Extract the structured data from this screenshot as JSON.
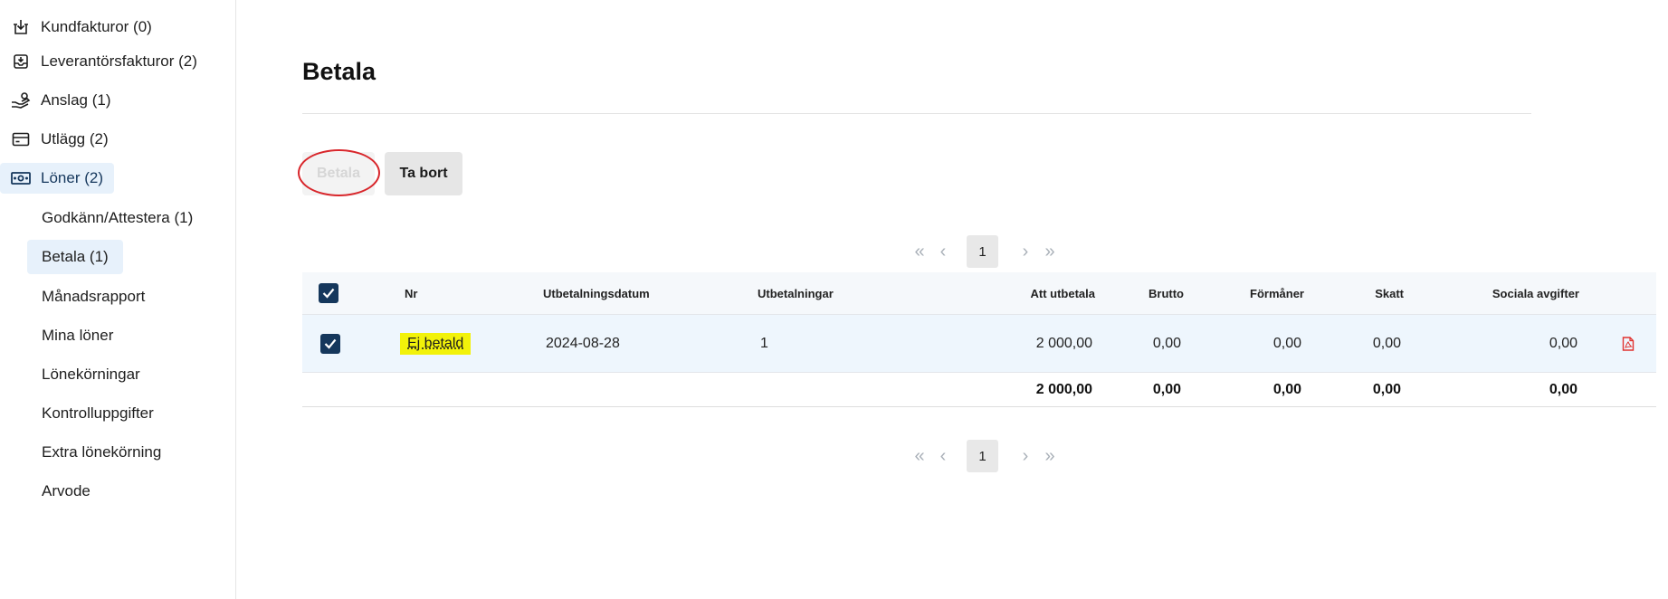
{
  "sidebar": {
    "items": [
      {
        "label": "Kundfakturor (0)",
        "icon": "receive-invoice-icon"
      },
      {
        "label": "Leverantörsfakturor (2)",
        "icon": "supplier-invoice-icon"
      },
      {
        "label": "Anslag (1)",
        "icon": "hand-coins-icon"
      },
      {
        "label": "Utlägg (2)",
        "icon": "card-icon"
      },
      {
        "label": "Löner (2)",
        "icon": "banknote-icon"
      }
    ],
    "sub_items": [
      {
        "label": "Godkänn/Attestera (1)"
      },
      {
        "label": "Betala (1)"
      },
      {
        "label": "Månadsrapport"
      },
      {
        "label": "Mina löner"
      },
      {
        "label": "Lönekörningar"
      },
      {
        "label": "Kontrolluppgifter"
      },
      {
        "label": "Extra lönekörning"
      },
      {
        "label": "Arvode"
      }
    ],
    "active_sub_item": "Betala (1)"
  },
  "main": {
    "title": "Betala",
    "buttons": {
      "pay": "Betala",
      "delete": "Ta bort"
    }
  },
  "pager": {
    "current_page": "1",
    "first": "«",
    "prev": "‹",
    "next": "›",
    "last": "»"
  },
  "table": {
    "headers": {
      "nr": "Nr",
      "date": "Utbetalningsdatum",
      "payouts": "Utbetalningar",
      "to_pay": "Att utbetala",
      "gross": "Brutto",
      "benefits": "Förmåner",
      "tax": "Skatt",
      "social_fees": "Sociala avgifter"
    },
    "row": {
      "selected": true,
      "status": "Ej betald",
      "date": "2024-08-28",
      "payouts": "1",
      "to_pay": "2 000,00",
      "gross": "0,00",
      "benefits": "0,00",
      "tax": "0,00",
      "social_fees": "0,00"
    },
    "totals": {
      "to_pay": "2 000,00",
      "gross": "0,00",
      "benefits": "0,00",
      "tax": "0,00",
      "social_fees": "0,00"
    }
  },
  "colors": {
    "accent_navy": "#15375c",
    "highlight_yellow": "#f2f20a",
    "annotation_red": "#d8262b",
    "pdf_red": "#e0322f",
    "active_bg": "#e7f1fb"
  }
}
